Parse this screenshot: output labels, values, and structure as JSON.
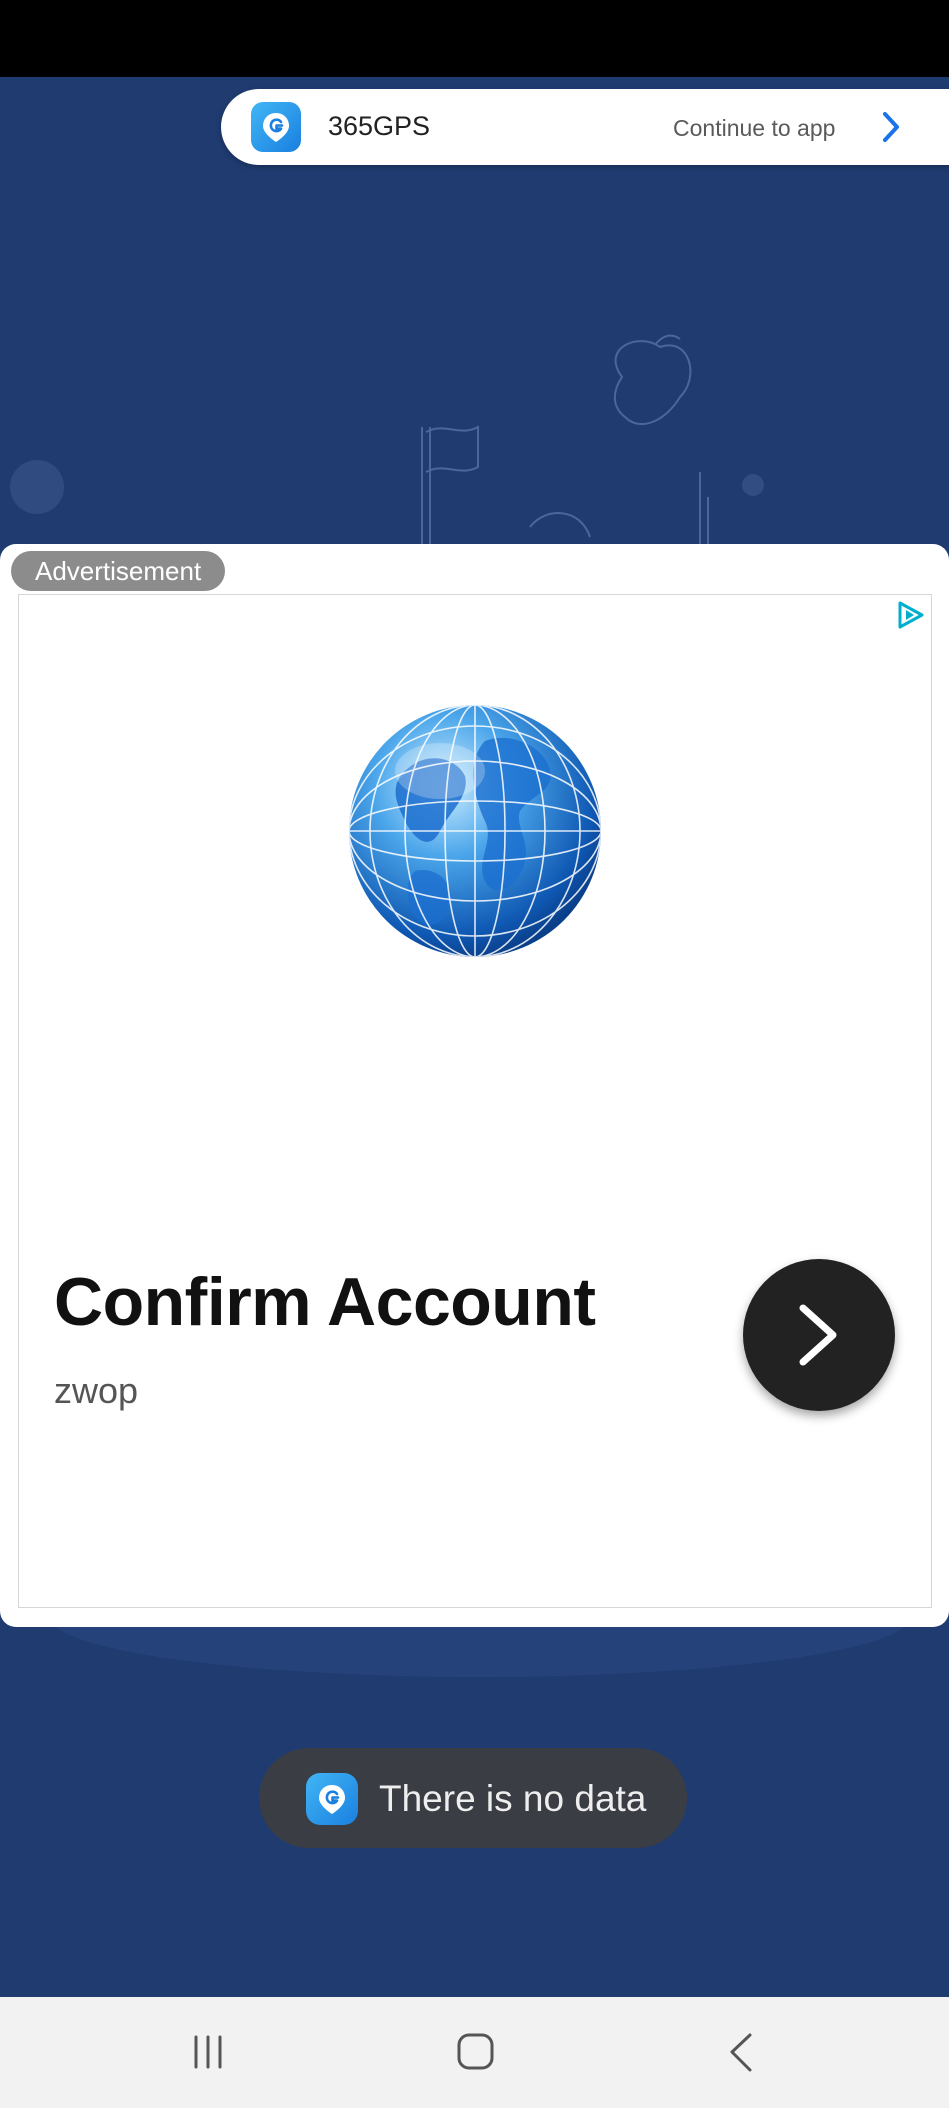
{
  "app_banner": {
    "app_name": "365GPS",
    "continue_label": "Continue to app",
    "icon": "location-g-icon"
  },
  "ad": {
    "badge": "Advertisement",
    "headline": "Confirm Account",
    "advertiser": "zwop",
    "adchoices_icon": "adchoices-icon",
    "image": "globe-image",
    "cta_icon": "chevron-right-icon"
  },
  "toast": {
    "message": "There is no data",
    "icon": "location-g-icon"
  },
  "navigation": {
    "recents_icon": "recents-icon",
    "home_icon": "home-icon",
    "back_icon": "back-icon"
  },
  "colors": {
    "app_background": "#1f3b70",
    "status_bar": "#000000",
    "toast_background": "#3a3d44",
    "accent_blue": "#1a7fe0",
    "cta_background": "#222222"
  }
}
